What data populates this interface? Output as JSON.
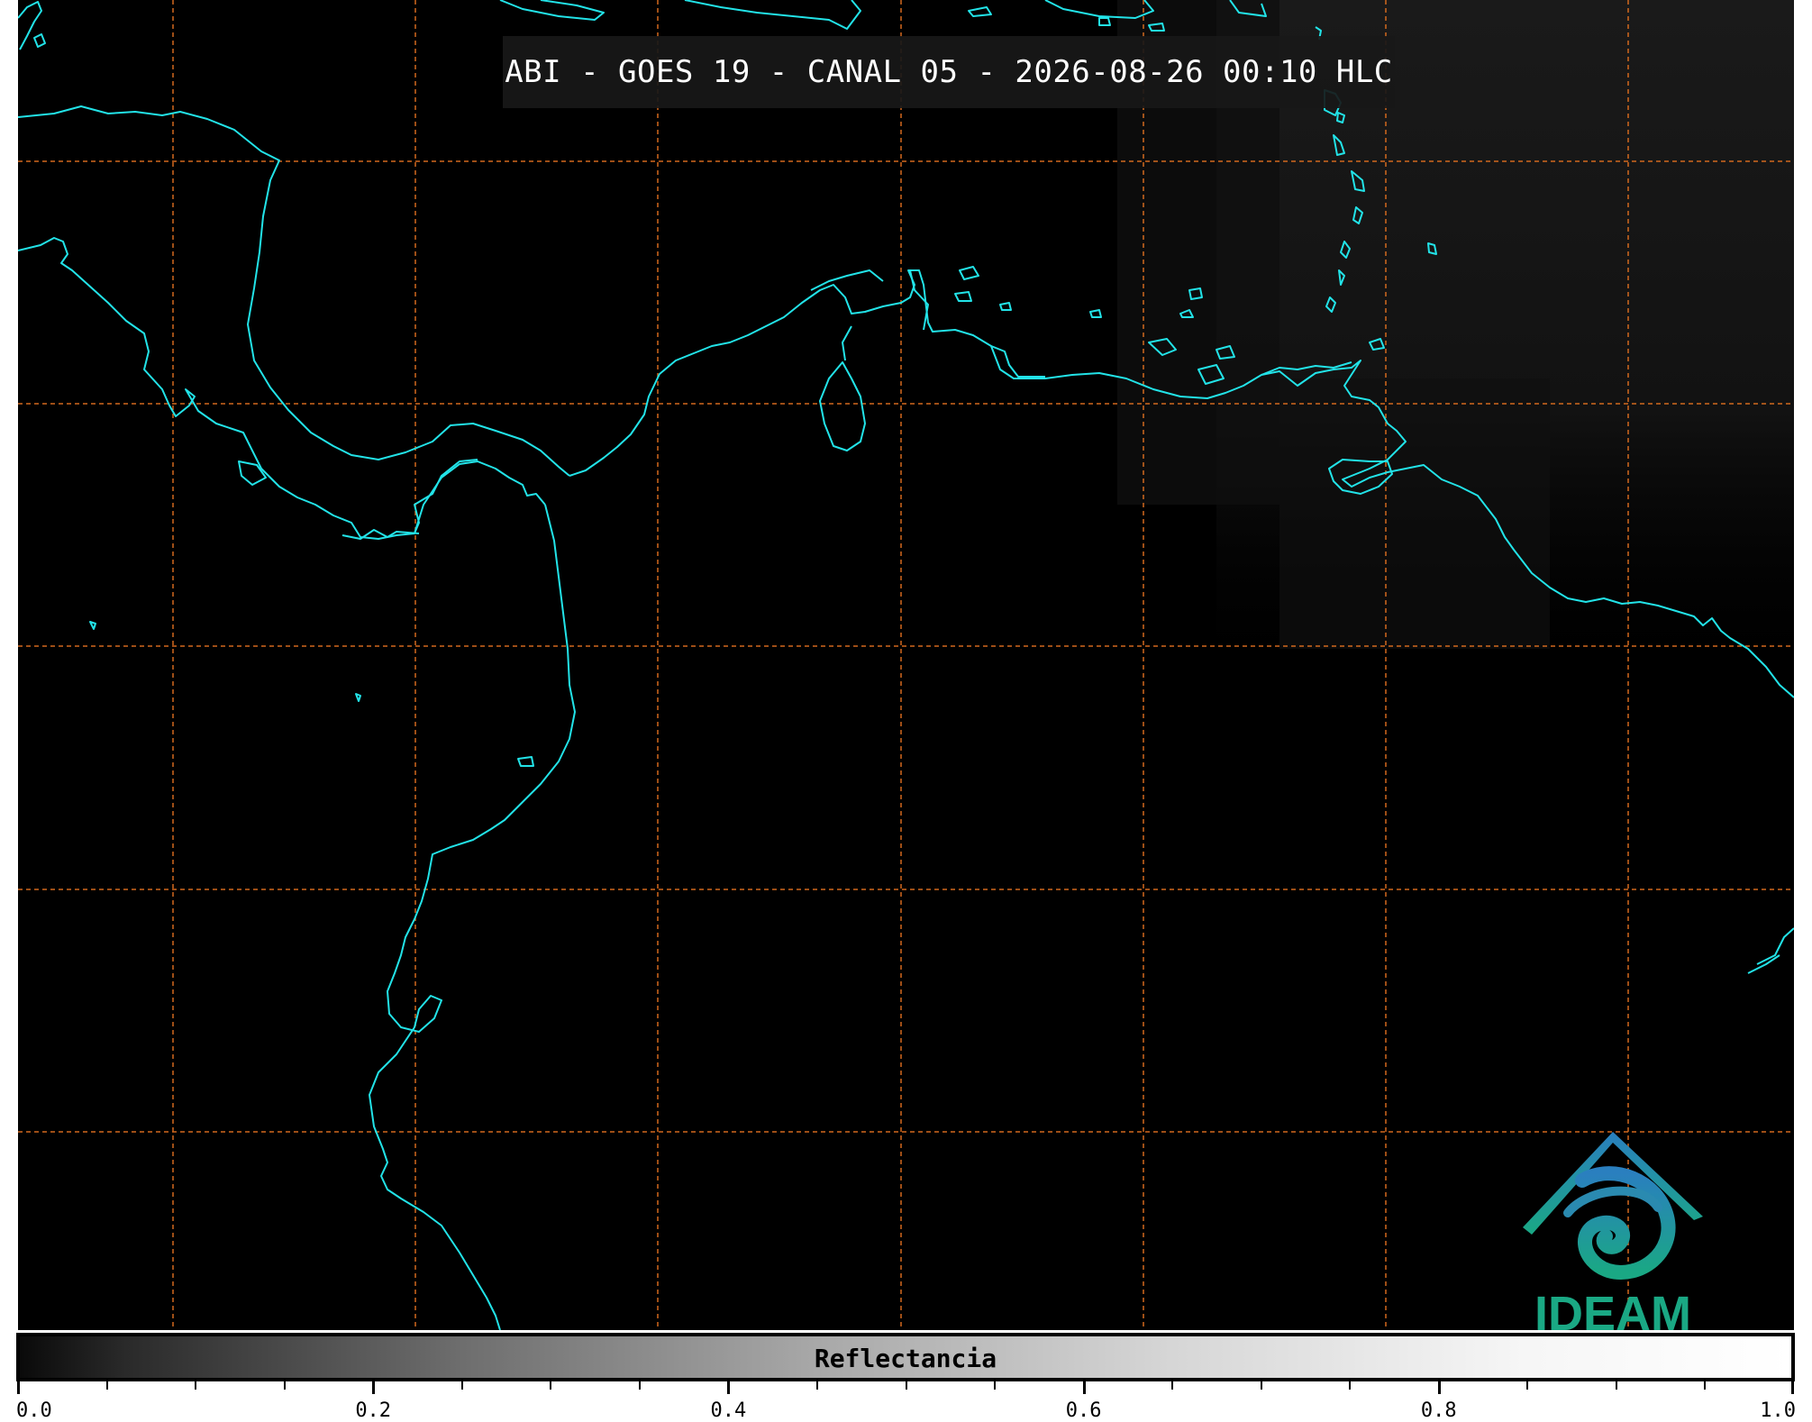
{
  "title": "ABI - GOES 19 - CANAL 05 - 2026-08-26 00:10 HLC",
  "colorbar": {
    "label": "Reflectancia",
    "range": [
      0.0,
      1.0
    ],
    "tick_labels": [
      "0.0",
      "0.2",
      "0.4",
      "0.6",
      "0.8",
      "1.0"
    ],
    "major_ticks": [
      0.0,
      0.2,
      0.4,
      0.6,
      0.8,
      1.0
    ],
    "minor_step": 0.05,
    "colormap": "grayscale black-to-white"
  },
  "map": {
    "background_color": "#000000",
    "coastline_color": "#22e3e8",
    "gridline_color": "#d2691e",
    "gridline_style": "dashed",
    "brighter_region": "upper-right dim gray haze"
  },
  "logo": {
    "text": "IDEAM",
    "icon": "ideam-logo-icon",
    "colors": [
      "#2a7fbf",
      "#1aa884"
    ]
  }
}
